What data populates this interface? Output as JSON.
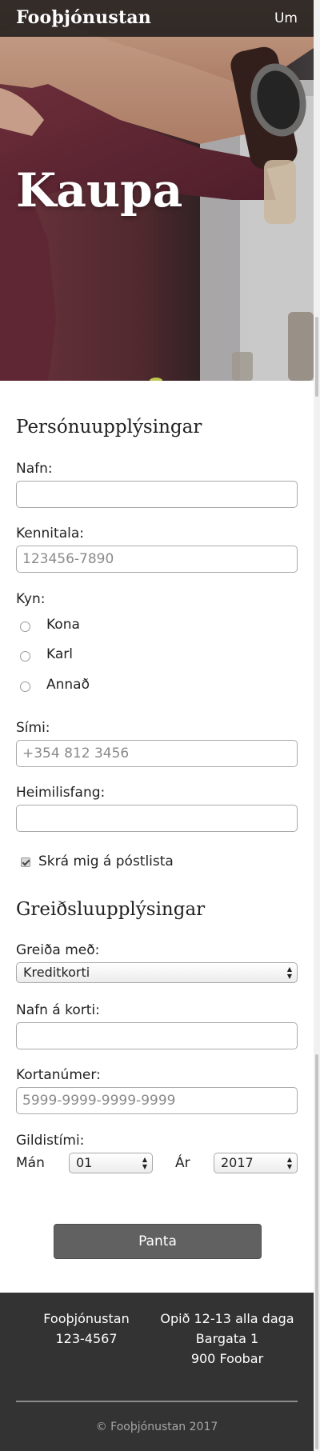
{
  "header": {
    "brand": "Fooþjónustan",
    "nav_link": "Um"
  },
  "hero": {
    "title": "Kaupa"
  },
  "personal": {
    "heading": "Persónuupplýsingar",
    "name_label": "Nafn:",
    "name_value": "",
    "kennitala_label": "Kennitala:",
    "kennitala_placeholder": "123456-7890",
    "gender_label": "Kyn:",
    "gender_options": [
      "Kona",
      "Karl",
      "Annað"
    ],
    "phone_label": "Sími:",
    "phone_placeholder": "+354 812 3456",
    "address_label": "Heimilisfang:",
    "address_value": "",
    "newsletter_label": "Skrá mig á póstlista",
    "newsletter_checked": true
  },
  "payment": {
    "heading": "Greiðsluupplýsingar",
    "method_label": "Greiða með:",
    "method_selected": "Kreditkorti",
    "cardname_label": "Nafn á korti:",
    "cardname_value": "",
    "cardnumber_label": "Kortanúmer:",
    "cardnumber_placeholder": "5999-9999-9999-9999",
    "expiry_label": "Gildistími:",
    "month_label": "Mán",
    "month_selected": "01",
    "year_label": "Ár",
    "year_selected": "2017"
  },
  "submit_label": "Panta",
  "footer": {
    "left_line1": "Fooþjónustan",
    "left_line2": "123-4567",
    "right_line1": "Opið 12-13 alla daga",
    "right_line2": "Bargata 1",
    "right_line3": "900 Foobar",
    "copyright": "© Fooþjónustan 2017"
  },
  "colors": {
    "topbar": "#1a1a1a",
    "button": "#616161",
    "footer": "#333333"
  }
}
